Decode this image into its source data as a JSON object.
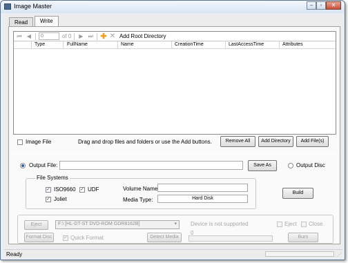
{
  "window": {
    "title": "Image Master"
  },
  "tabs": [
    {
      "label": "Read"
    },
    {
      "label": "Write"
    }
  ],
  "navigator": {
    "position_value": "0",
    "count_label": "of 0",
    "add_root_label": "Add Root Directory"
  },
  "file_list": {
    "columns": [
      "Type",
      "FullName",
      "Name",
      "CreationTime",
      "LastAccessTime",
      "Attributes"
    ],
    "rows": []
  },
  "list_footer": {
    "image_file_label": "Image File",
    "hint": "Drag and drop files and folders or use the Add buttons.",
    "remove_all": "Remove All",
    "add_directory": "Add Directory",
    "add_files": "Add File(s)"
  },
  "output": {
    "output_file_label": "Output File:",
    "output_file_value": "",
    "save_as": "Save As",
    "output_disc_label": "Output Disc"
  },
  "file_systems": {
    "group_label": "File Systems",
    "iso9660": "ISO9660",
    "udf": "UDF",
    "joliet": "Joliet",
    "volume_name_label": "Volume Name:",
    "volume_name_value": "",
    "media_type_label": "Media Type:",
    "media_type_value": "Hard Disk",
    "build": "Build"
  },
  "disc": {
    "eject": "Eject",
    "drive_value": "F:\\ [HL-DT-ST DVD-ROM GDR8162B]",
    "device_status": "Device is not supported",
    "eject_check": "Eject",
    "close_check": "Close",
    "format_disc": "Format Disc",
    "quick_format": "Quick Format",
    "detect_media": "Detect Media",
    "progress_value": "0",
    "burn": "Burn"
  },
  "status": {
    "text": "Ready"
  }
}
